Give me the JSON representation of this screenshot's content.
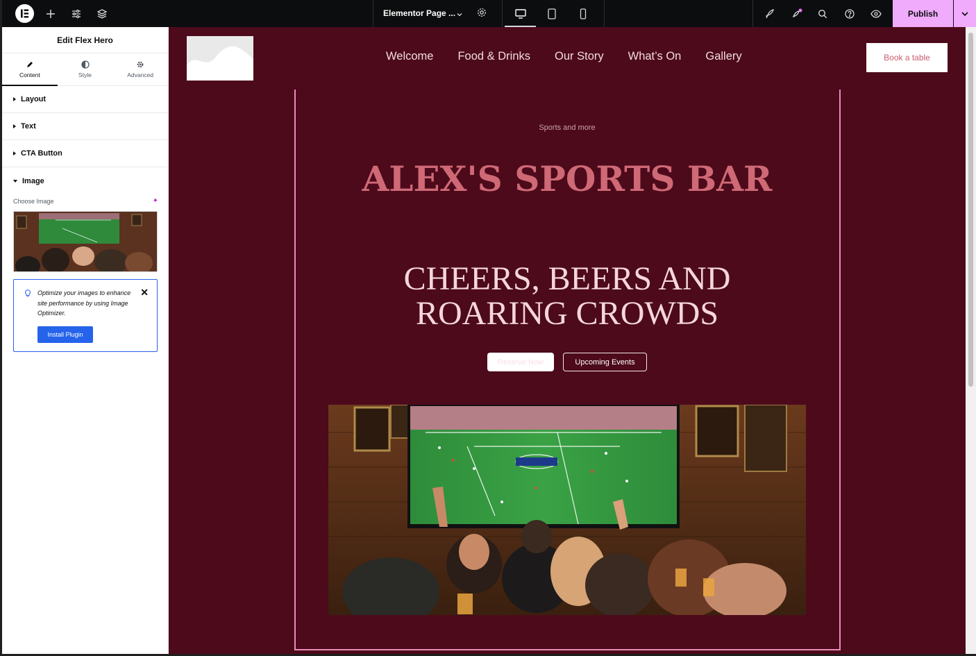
{
  "topbar": {
    "document_title": "Elementor Page ...",
    "publish_label": "Publish"
  },
  "panel": {
    "title": "Edit Flex Hero",
    "tabs": [
      {
        "label": "Content",
        "icon": "pencil-icon"
      },
      {
        "label": "Style",
        "icon": "half-circle-icon"
      },
      {
        "label": "Advanced",
        "icon": "gear-icon"
      }
    ],
    "sections": [
      {
        "label": "Layout"
      },
      {
        "label": "Text"
      },
      {
        "label": "CTA Button"
      },
      {
        "label": "Image"
      }
    ],
    "choose_image_label": "Choose Image",
    "notice": {
      "message": "Optimize your images to enhance site performance by using Image Optimizer.",
      "button_label": "Install Plugin"
    }
  },
  "site": {
    "nav": [
      "Welcome",
      "Food & Drinks",
      "Our Story",
      "What’s On",
      "Gallery"
    ],
    "book_label": "Book a table",
    "eyebrow": "Sports and more",
    "headline": "ALEX'S SPORTS BAR",
    "subheadline": "CHEERS, BEERS AND ROARING CROWDS",
    "cta_primary": "Reserve Now",
    "cta_secondary": "Upcoming Events"
  },
  "colors": {
    "canvas_bg": "#4d0a1b",
    "accent_pink": "#f0abfc",
    "headline": "#cf6976",
    "frame": "#e58fb8",
    "notice_blue": "#2563eb"
  }
}
